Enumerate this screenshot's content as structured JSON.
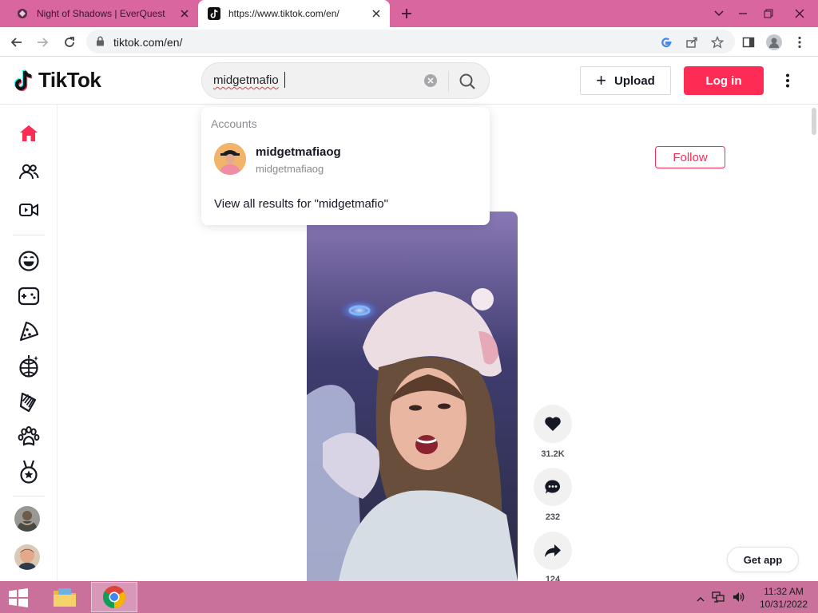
{
  "browser": {
    "tabs": [
      {
        "title": "Night of Shadows | EverQuest",
        "favicon": "everquest-icon",
        "active": false
      },
      {
        "title": "https://www.tiktok.com/en/",
        "favicon": "tiktok-icon",
        "active": true
      }
    ],
    "address": "tiktok.com/en/"
  },
  "header": {
    "logo_text": "TikTok",
    "search_value": "midgetmafio",
    "upload_label": "Upload",
    "login_label": "Log in"
  },
  "dropdown": {
    "section_label": "Accounts",
    "account": {
      "name": "midgetmafiaog",
      "handle": "midgetmafiaog"
    },
    "view_all": "View all results for \"midgetmafio\""
  },
  "sidebar": {
    "items": [
      "home-icon",
      "following-icon",
      "live-icon",
      "comedy-icon",
      "gaming-icon",
      "food-icon",
      "dance-icon",
      "beauty-icon",
      "animals-icon",
      "sports-icon"
    ]
  },
  "feed": {
    "follow_label": "Follow",
    "likes": "31.2K",
    "comments": "232",
    "shares": "124"
  },
  "get_app_label": "Get app",
  "taskbar": {
    "time": "11:32 AM",
    "date": "10/31/2022"
  },
  "colors": {
    "brand": "#fe2c55",
    "tabstrip": "#d9669e",
    "taskbar": "#c9719b"
  }
}
